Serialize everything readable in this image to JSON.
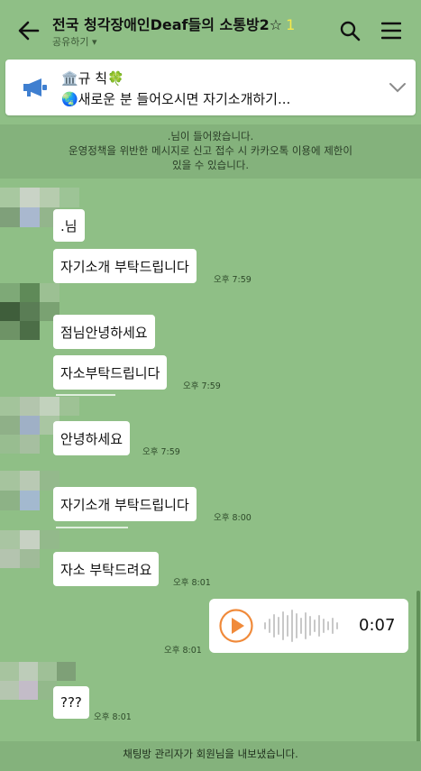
{
  "header": {
    "title": "전국 청각장애인Deaf들의 소통방2☆",
    "member_count": "1",
    "subtitle": "공유하기 ▾",
    "icons": [
      "back-arrow-icon",
      "search-icon",
      "hamburger-menu-icon"
    ]
  },
  "notice": {
    "line1": "🏛️규   칙🍀",
    "line2": "🌏새로운 분 들어오시면 자기소개하기...",
    "icon": "megaphone-icon"
  },
  "system": {
    "line1": ".님이 들어왔습니다.",
    "line2": "운영정책을 위반한 메시지로 신고 접수 시 카카오톡 이용에 제한이",
    "line3": "있을 수 있습니다."
  },
  "messages": [
    {
      "text": ".님",
      "time": ""
    },
    {
      "text": "자기소개 부탁드립니다",
      "time": "오후 7:59"
    },
    {
      "text": "점님안녕하세요",
      "time": ""
    },
    {
      "text": "자소부탁드립니다",
      "time": "오후 7:59"
    },
    {
      "text": "안녕하세요",
      "time": "오후 7:59"
    },
    {
      "text": "자기소개 부탁드립니다",
      "time": "오후 8:00"
    },
    {
      "text": "자소 부탁드려요",
      "time": "오후 8:01"
    },
    {
      "text": "???",
      "time": "오후 8:01"
    }
  ],
  "voice": {
    "duration": "0:07",
    "time": "오후 8:01"
  },
  "footer": {
    "text": "채팅방 관리자가 회원님을 내보냈습니다."
  },
  "colors": {
    "background": "#8fbf86",
    "bubble": "#ffffff",
    "play_accent": "#f08a3a"
  }
}
